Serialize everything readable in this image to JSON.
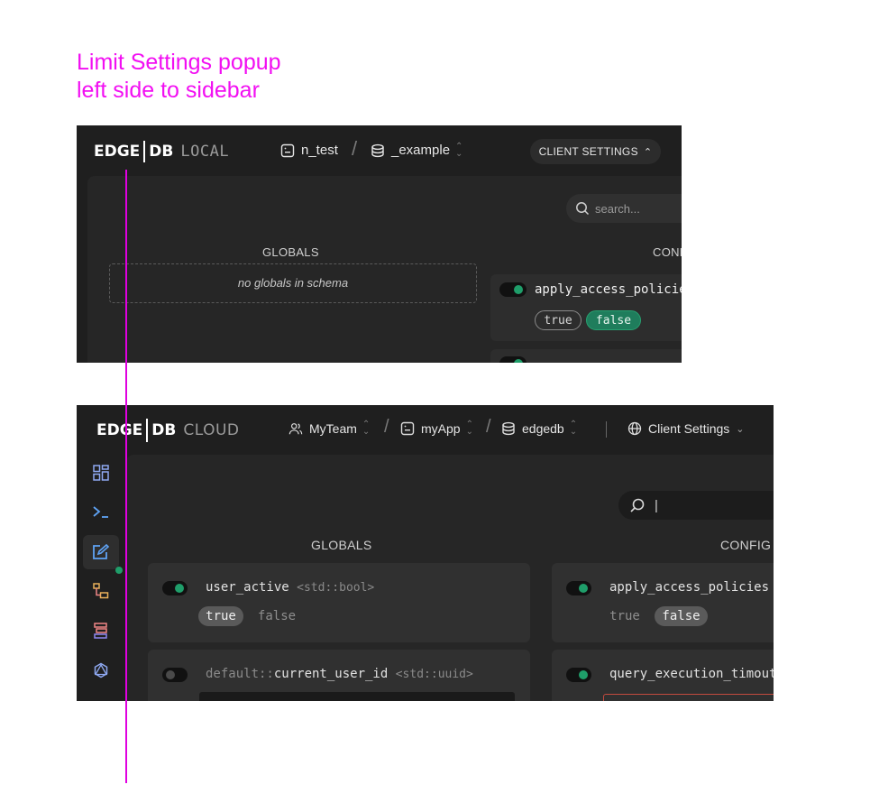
{
  "annotation": {
    "line1": "Limit Settings popup",
    "line2": "left side to sidebar",
    "color": "#f20ff2"
  },
  "local": {
    "logo": {
      "edge": "EDGE",
      "db": "DB",
      "sub": "LOCAL"
    },
    "breadcrumb": {
      "instance": "n_test",
      "database": "_example"
    },
    "client_settings_label": "CLIENT SETTINGS",
    "search_placeholder": "search...",
    "globals_title": "GLOBALS",
    "config_title": "CONFI",
    "no_globals": "no globals in schema",
    "config_item": {
      "name": "apply_access_policie",
      "true_label": "true",
      "false_label": "false",
      "enabled": true,
      "selected": "false"
    }
  },
  "cloud": {
    "logo": {
      "edge": "EDGE",
      "db": "DB",
      "sub": "CLOUD"
    },
    "breadcrumb": {
      "team": "MyTeam",
      "app": "myApp",
      "database": "edgedb"
    },
    "client_settings_label": "Client Settings",
    "search_value": "|",
    "globals_title": "GLOBALS",
    "config_title": "CONFIG",
    "sidebar": [
      "dashboard-icon",
      "repl-icon",
      "editor-icon",
      "schema-icon",
      "data-icon",
      "graphql-icon"
    ],
    "globals": [
      {
        "name": "user_active",
        "type": "<std::bool>",
        "enabled": true,
        "true_label": "true",
        "false_label": "false",
        "selected": "true"
      },
      {
        "prefix": "default::",
        "name": "current_user_id",
        "type": "<std::uuid>",
        "enabled": false
      }
    ],
    "config": [
      {
        "name": "apply_access_policies",
        "enabled": true,
        "true_label": "true",
        "false_label": "false",
        "selected": "false"
      },
      {
        "name": "query_execution_timout",
        "enabled": true
      }
    ]
  }
}
